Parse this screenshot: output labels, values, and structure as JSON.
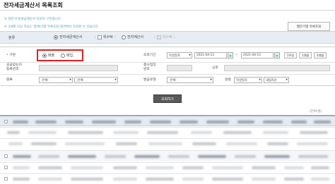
{
  "page": {
    "title": "전자세금계산서 목록조회",
    "notices": [
      "※ 결본·수정세금계산서 작성이 구분됩니다.",
      "※ 3개월 이상 지났는 발/편기별 목록조회 화면에서 조회할 수 있습니다."
    ],
    "monthly_button": "월분기별 목록조회"
  },
  "category": {
    "label": "분류",
    "options": [
      {
        "label": "전자세금계산서",
        "type": "radio",
        "selected": true
      },
      {
        "label": "위수탁",
        "type": "checkbox",
        "checked": false
      },
      {
        "label": "전자계산서",
        "type": "radio",
        "selected": false
      },
      {
        "label": "위수탁",
        "type": "checkbox",
        "checked": false,
        "disabled": true
      }
    ]
  },
  "form": {
    "type_label": "구분",
    "type_options": [
      {
        "label": "매출",
        "selected": true
      },
      {
        "label": "매입",
        "selected": false
      }
    ],
    "period_label": "조회기간",
    "date_type": "작성일자",
    "date_from": "2021-04-13",
    "date_to": "2021-04-13",
    "period_buttons": [
      "1주일",
      "1개월",
      "3개월"
    ],
    "biz_no_label_1": "공급받는자",
    "biz_no_label_2": "등록번호",
    "branch_label_1": "종사업장",
    "branch_label_2": "번호",
    "trade_name_label": "상호",
    "kind_label": "종류",
    "kind_value_1": "-전체-",
    "kind_value_2": "-전체-",
    "issue_type_label": "발급유형",
    "issue_type_value": "-전체-",
    "sort_label": "정렬",
    "sort_field": "작성일자",
    "sort_order": "내림차순"
  },
  "actions": {
    "search_button": "조회하기"
  },
  "results": {
    "unit_label": "(단위:원)"
  },
  "colors": {
    "highlight_box": "#e02020",
    "notice_text": "#5aa0b8",
    "header_band": "#e8edf4"
  }
}
